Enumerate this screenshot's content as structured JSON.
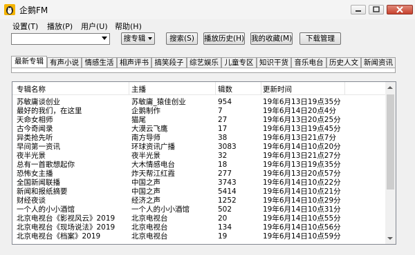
{
  "window": {
    "title": "企鹅FM"
  },
  "menu": [
    "设置(T)",
    "播放(P)",
    "用户(U)",
    "帮助(H)"
  ],
  "toolbar": {
    "search_input_value": "",
    "search_type": "搜专辑",
    "search_btn": "搜索(S)",
    "history_btn": "播放历史(H)",
    "fav_btn": "我的收藏(M)",
    "download_btn": "下载管理"
  },
  "tabs": [
    "最新专辑",
    "有声小说",
    "情感生活",
    "相声评书",
    "搞笑段子",
    "综艺娱乐",
    "儿童专区",
    "知识干货",
    "音乐电台",
    "历史人文",
    "新闻资讯"
  ],
  "table": {
    "headers": [
      "专辑名称",
      "主播",
      "辑数",
      "更新时间"
    ],
    "rows": [
      [
        "苏敏庸谈创业",
        "苏敏庸_猿佳创业",
        "954",
        "19年6月13日19点35分"
      ],
      [
        "最好的我们，在这里",
        "企鹅制作",
        "7",
        "19年6月14日20点4分"
      ],
      [
        "天命女相师",
        "猫尾",
        "27",
        "19年6月13日20点25分"
      ],
      [
        "古今奇闻录",
        "大漠云飞鹰",
        "17",
        "19年6月13日19点45分"
      ],
      [
        "异类抢先听",
        "南方导师",
        "38",
        "19年6月13日21点7分"
      ],
      [
        "早间第一资讯",
        "环球资讯广播",
        "3083",
        "19年6月14日10点20分"
      ],
      [
        "夜半光景",
        "夜半光景",
        "32",
        "19年6月13日21点27分"
      ],
      [
        "总有一首歌想起你",
        "大木情感电台",
        "18",
        "19年6月13日19点35分"
      ],
      [
        "恐怖女主播",
        "炸天帮江红霞",
        "277",
        "19年6月13日20点57分"
      ],
      [
        "全国新闻联播",
        "中国之声",
        "3743",
        "19年6月14日10点22分"
      ],
      [
        "新闻和报纸摘要",
        "中国之声",
        "5414",
        "19年6月14日10点21分"
      ],
      [
        "财经夜谈",
        "经济之声",
        "1252",
        "19年6月14日10点29分"
      ],
      [
        "一个人的小小酒馆",
        "一个人的小小酒馆",
        "502",
        "19年6月14日10点31分"
      ],
      [
        "北京电视台《影视风云》2019",
        "北京电视台",
        "20",
        "19年6月14日10点55分"
      ],
      [
        "北京电视台《现场说法》2019",
        "北京电视台",
        "134",
        "19年6月14日10点56分"
      ],
      [
        "北京电视台《档案》2019",
        "北京电视台",
        "19",
        "19年6月14日10点59分"
      ]
    ]
  },
  "icons": {
    "app": "penguin-icon",
    "minimize": "minimize-icon",
    "maximize": "maximize-icon",
    "close": "close-icon"
  },
  "colors": {
    "close_button": "#c8432f",
    "list_bg": "#ffffff",
    "window_bg": "#f0f0f0"
  }
}
